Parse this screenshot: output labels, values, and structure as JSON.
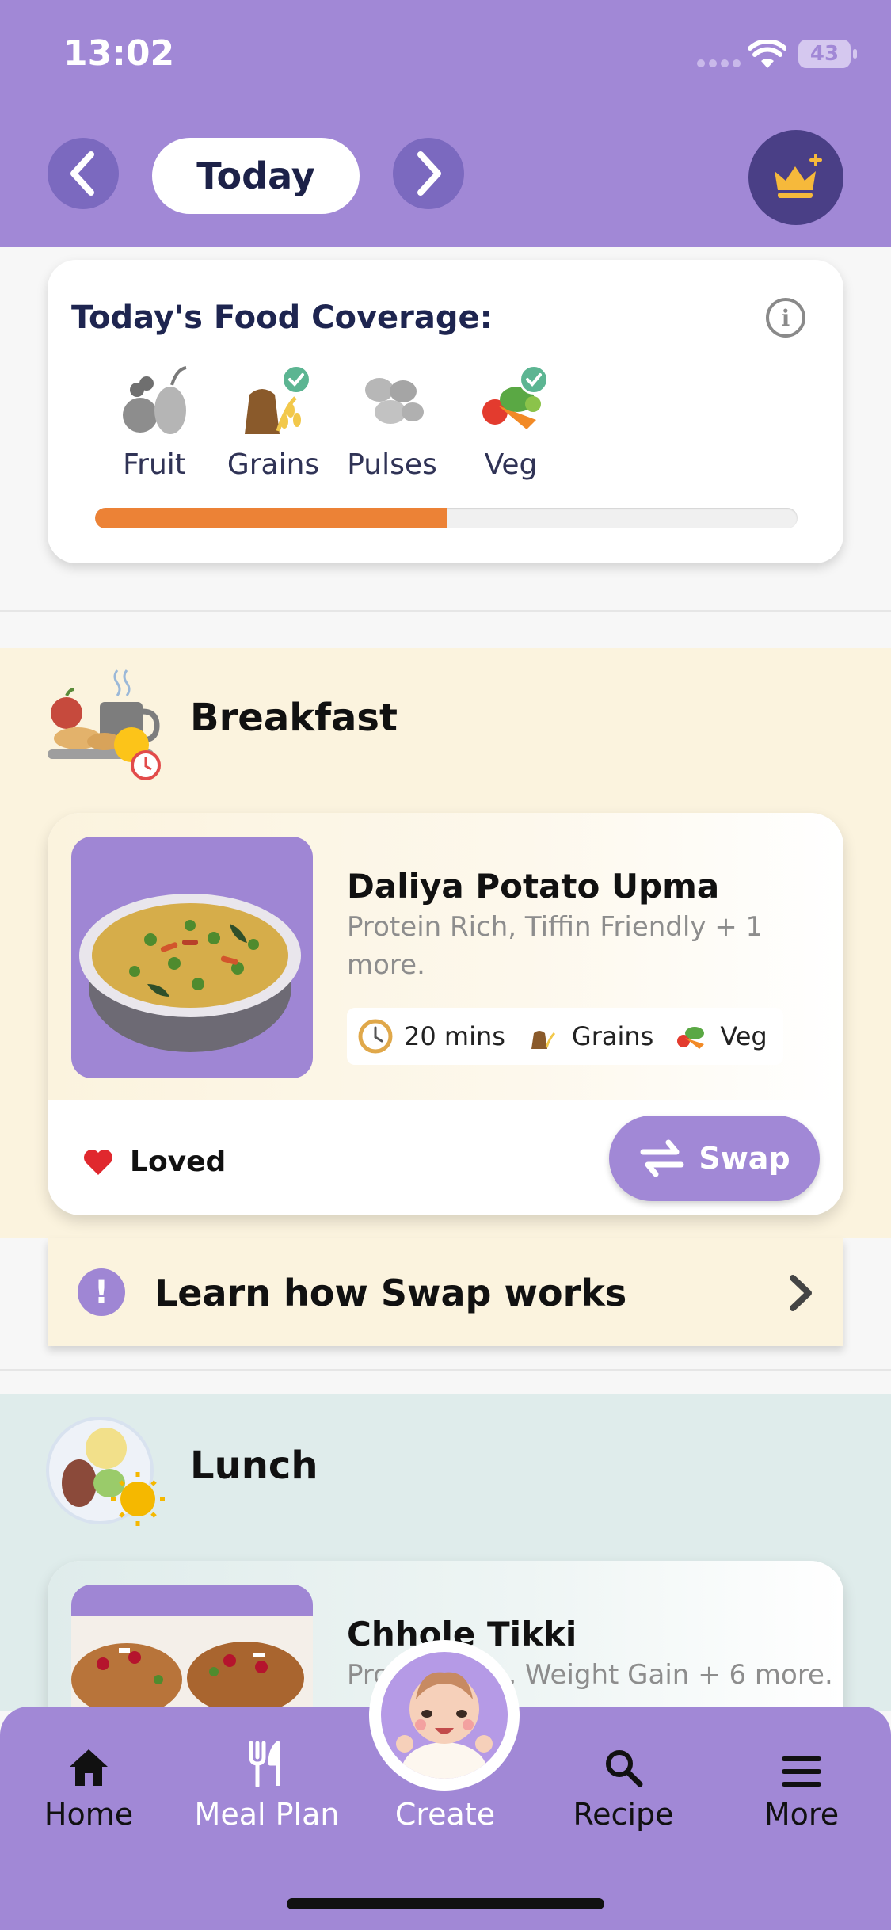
{
  "status": {
    "time": "13:02",
    "battery": "43"
  },
  "header": {
    "date_label": "Today"
  },
  "coverage": {
    "title": "Today's Food Coverage:",
    "progress_percent": 50,
    "groups": [
      {
        "label": "Fruit",
        "covered": false
      },
      {
        "label": "Grains",
        "covered": true
      },
      {
        "label": "Pulses",
        "covered": false
      },
      {
        "label": "Veg",
        "covered": true
      }
    ]
  },
  "breakfast": {
    "title": "Breakfast",
    "meal": {
      "name": "Daliya Potato Upma",
      "description": "Protein Rich, Tiffin Friendly + 1 more.",
      "time": "20 mins",
      "tags": [
        "Grains",
        "Veg"
      ]
    },
    "loved_label": "Loved",
    "swap_label": "Swap"
  },
  "learn": {
    "label": "Learn how Swap works"
  },
  "lunch": {
    "title": "Lunch",
    "meal": {
      "name": "Chhole Tikki",
      "description": "Protein Rich, Weight Gain + 6 more."
    }
  },
  "nav": {
    "home": "Home",
    "meal_plan": "Meal Plan",
    "create": "Create",
    "recipe": "Recipe",
    "more": "More"
  },
  "colors": {
    "brand_purple": "#a188d6",
    "progress_orange": "#ec8236",
    "breakfast_bg": "#fbf3de",
    "lunch_bg": "#dfeceb"
  }
}
